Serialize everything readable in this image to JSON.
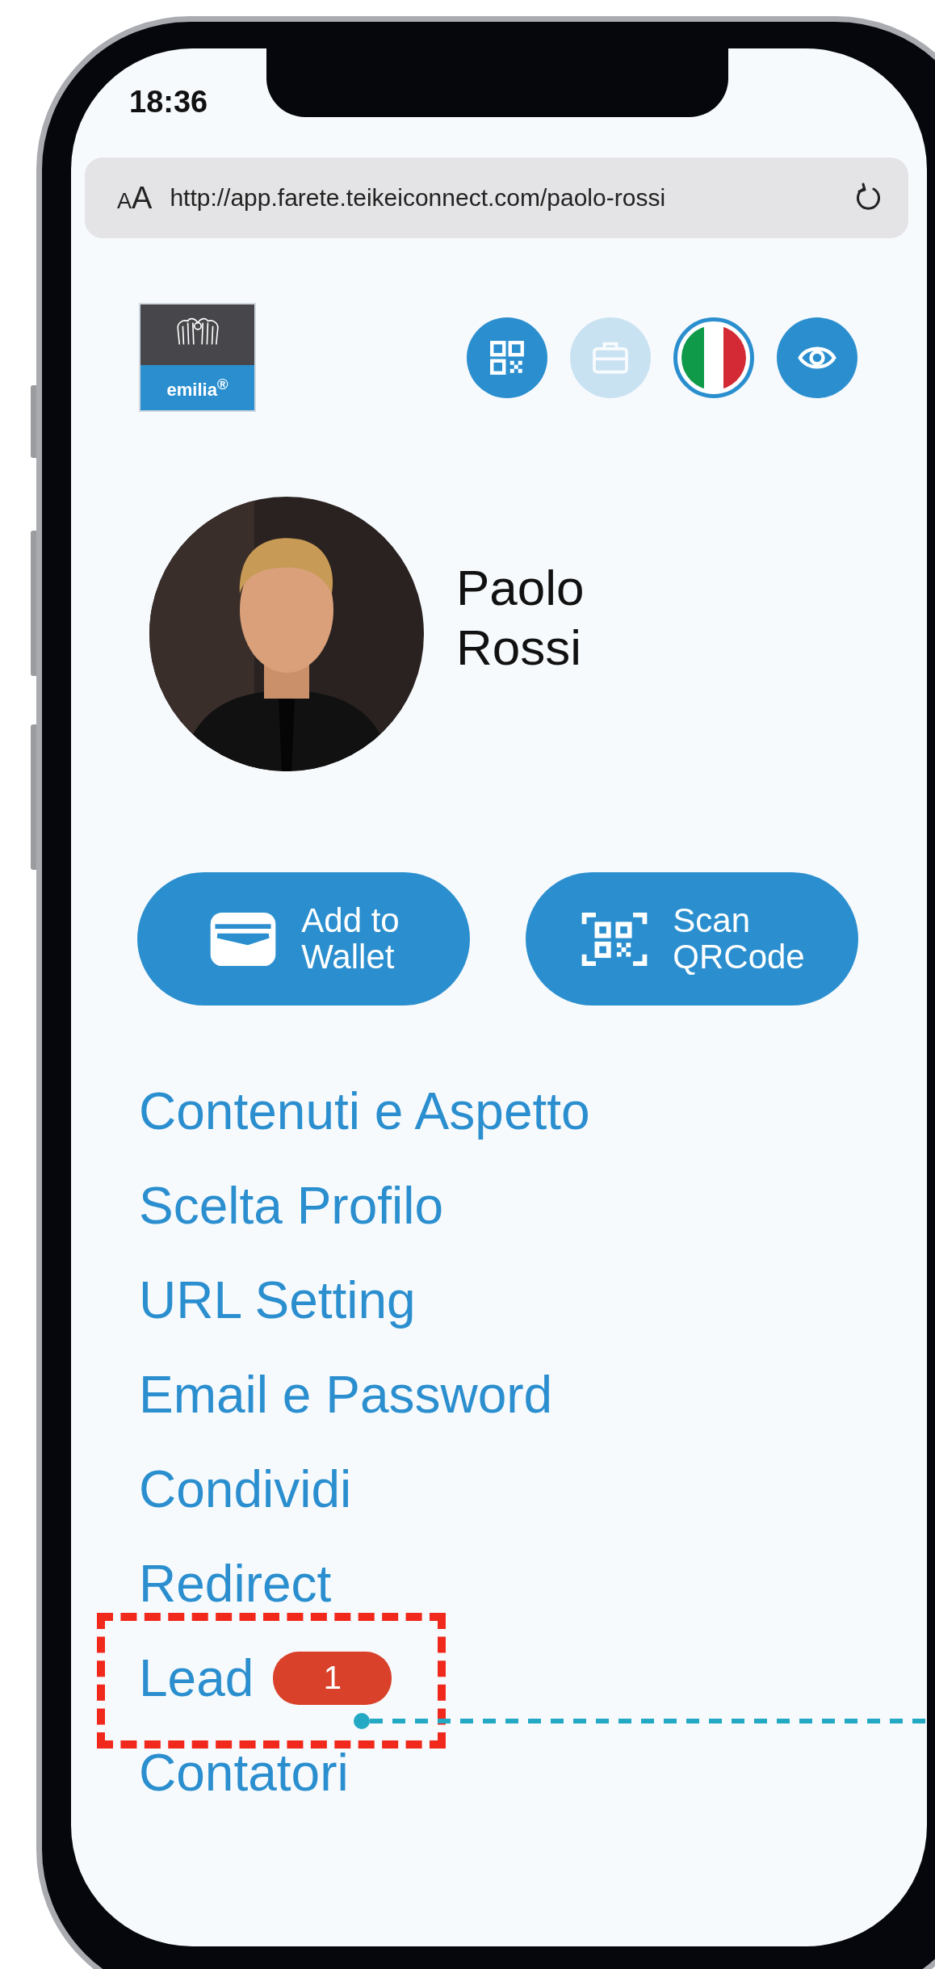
{
  "status_bar": {
    "time": "18:36"
  },
  "address_bar": {
    "text_size_button": "AA",
    "url": "http://app.farete.teikeiconnect.com/paolo-rossi"
  },
  "logo": {
    "text": "emilia$^{®}$"
  },
  "header_icons": [
    {
      "kind": "qr",
      "disabled": false
    },
    {
      "kind": "briefcase",
      "disabled": true
    },
    {
      "kind": "flag",
      "disabled": false
    },
    {
      "kind": "eye",
      "disabled": false
    }
  ],
  "profile": {
    "first_name": "Paolo",
    "last_name": "Rossi"
  },
  "actions": [
    {
      "kind": "wallet",
      "label": "Add to\nWallet"
    },
    {
      "kind": "scan",
      "label": "Scan\nQRCode"
    }
  ],
  "menu": [
    {
      "label": "Contenuti e Aspetto",
      "highlighted": false
    },
    {
      "label": "Scelta Profilo",
      "highlighted": false
    },
    {
      "label": "URL Setting",
      "highlighted": false
    },
    {
      "label": "Email e Password",
      "highlighted": false
    },
    {
      "label": "Condividi",
      "highlighted": false
    },
    {
      "label": "Redirect",
      "highlighted": false
    },
    {
      "label": "Lead",
      "badge": "1",
      "highlighted": true
    },
    {
      "label": "Contatori",
      "highlighted": false
    }
  ]
}
